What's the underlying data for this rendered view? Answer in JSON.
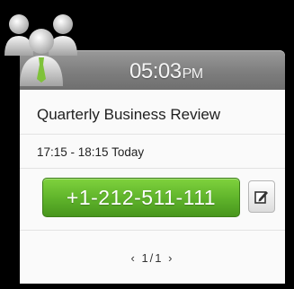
{
  "header": {
    "time": "05:03",
    "ampm": "PM",
    "icon": "contacts-people-icon"
  },
  "appointment": {
    "title": "Quarterly Business Review",
    "when": "17:15 - 18:15 Today",
    "phone": "+1-212-511-111"
  },
  "edit": {
    "icon": "edit-note-icon"
  },
  "pager": {
    "prev": "‹",
    "text": "1/1",
    "next": "›"
  },
  "colors": {
    "call_green": "#5eb22a",
    "header_gray": "#858585",
    "background": "#000000"
  }
}
